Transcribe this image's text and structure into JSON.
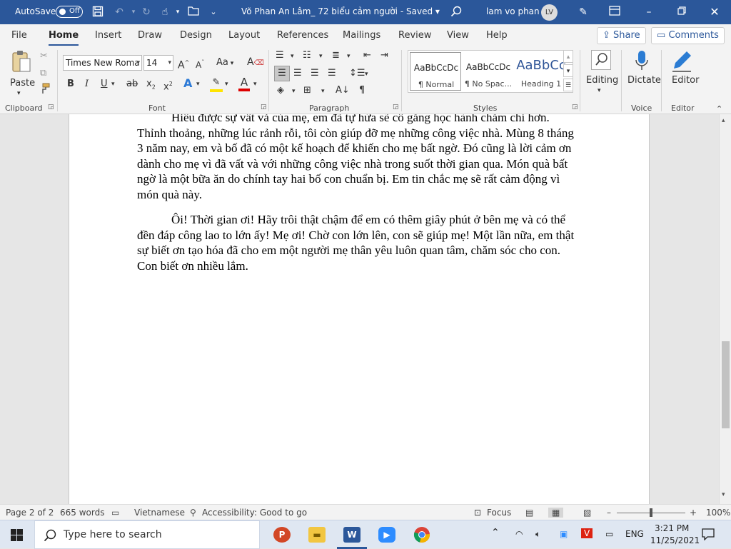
{
  "titlebar": {
    "autosave_label": "AutoSave",
    "autosave_state": "Off",
    "doc_title": "Võ Phan An Lâm_ 72 biểu cảm người",
    "save_status": "Saved",
    "user_name": "lam vo phan",
    "user_initials": "LV"
  },
  "menu_tabs": [
    "File",
    "Home",
    "Insert",
    "Draw",
    "Design",
    "Layout",
    "References",
    "Mailings",
    "Review",
    "View",
    "Help"
  ],
  "actions": {
    "share": "Share",
    "comments": "Comments"
  },
  "ribbon": {
    "paste": "Paste",
    "font_name": "Times New Roma",
    "font_size": "14",
    "case_btn": "Aa",
    "groups": {
      "clipboard": "Clipboard",
      "font": "Font",
      "paragraph": "Paragraph",
      "styles": "Styles",
      "voice": "Voice",
      "editor": "Editor"
    },
    "styles": [
      {
        "sample": "AaBbCcDc",
        "name": "¶ Normal"
      },
      {
        "sample": "AaBbCcDc",
        "name": "¶ No Spac..."
      },
      {
        "sample": "AaBbCc",
        "name": "Heading 1"
      }
    ],
    "editing": "Editing",
    "dictate": "Dictate",
    "editor_btn": "Editor"
  },
  "document": {
    "paragraphs": [
      "Hiểu được sự vất vả của mẹ, em đã tự hứa sẽ cố gắng học hành chăm chỉ hơn. Thỉnh thoảng, những lúc rảnh rỗi, tôi còn giúp đỡ mẹ những công việc nhà. Mùng 8 tháng 3 năm nay, em  và bố đã có một kế hoạch để khiến cho mẹ bất ngờ. Đó cũng là lời cảm ơn dành cho mẹ vì đã vất và với những công việc nhà trong suốt thời gian qua. Món quà bất ngờ là một bữa ăn do chính tay hai bố con chuẩn bị. Em tin chắc mẹ sẽ rất cảm động vì món quà này.",
      "Ôi! Thời gian ơi! Hãy trôi thật chậm để em có thêm giây phút ở bên mẹ và có thể đền đáp công lao to lớn ấy! Mẹ ơi! Chờ con lớn lên, con sẽ giúp mẹ! Một lần nữa, em thật sự biết ơn tạo hóa đã cho em một người mẹ thân yêu luôn quan tâm, chăm sóc cho con. Con biết ơn nhiều lắm."
    ]
  },
  "statusbar": {
    "page": "Page 2 of 2",
    "words": "665 words",
    "language": "Vietnamese",
    "accessibility": "Accessibility: Good to go",
    "focus": "Focus",
    "zoom": "100%"
  },
  "taskbar": {
    "search_placeholder": "Type here to search",
    "lang": "ENG",
    "time": "3:21 PM",
    "date": "11/25/2021"
  }
}
